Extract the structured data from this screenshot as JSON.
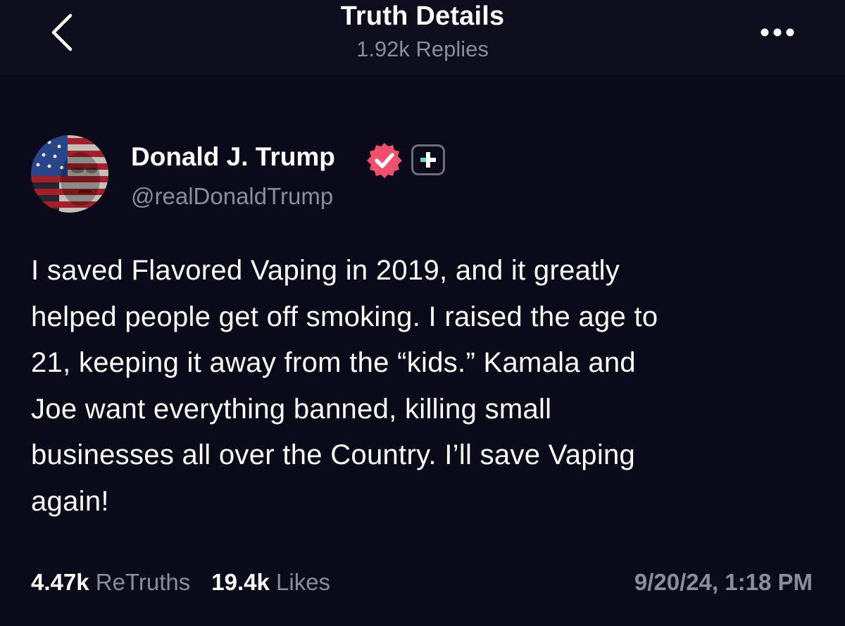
{
  "header": {
    "title": "Truth Details",
    "replies": "1.92k Replies",
    "back_icon": "chevron-left-icon",
    "more_icon": "more-horizontal-icon"
  },
  "author": {
    "name": "Donald J. Trump",
    "handle": "@realDonaldTrump",
    "verified_color": "#f0506e",
    "badge_accent": "#5de0c8"
  },
  "post": {
    "lines": [
      "I saved Flavored Vaping in 2019, and it greatly",
      "helped people get off smoking. I raised the age to",
      "21, keeping it away from the “kids.” Kamala and",
      "Joe want everything banned, killing small",
      "businesses all over the Country. I’ll save Vaping",
      "again!"
    ]
  },
  "stats": {
    "retruths_count": "4.47k",
    "retruths_label": "ReTruths",
    "likes_count": "19.4k",
    "likes_label": "Likes"
  },
  "timestamp": "9/20/24, 1:18 PM",
  "colors": {
    "background": "#0a0a1a",
    "muted_text": "#8c8c9e"
  }
}
